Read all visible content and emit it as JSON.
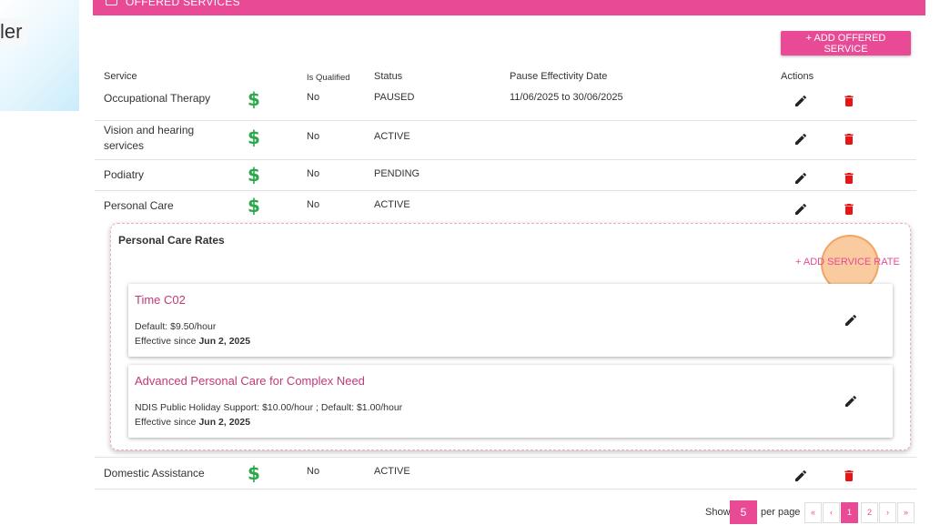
{
  "left_fragment": "ler",
  "panel_header": {
    "title": "OFFERED SERVICES"
  },
  "toolbar": {
    "add_offered_service": "+ ADD OFFERED SERVICE"
  },
  "table": {
    "headers": {
      "service": "Service",
      "is_qualified": "Is Qualified",
      "status": "Status",
      "pause": "Pause Effectivity Date",
      "actions": "Actions"
    },
    "rows": [
      {
        "service": "Occupational Therapy",
        "dollar": "$",
        "qualified": "No",
        "status": "PAUSED",
        "pause": "11/06/2025 to 30/06/2025"
      },
      {
        "service": "Vision and hearing services",
        "dollar": "$",
        "qualified": "No",
        "status": "ACTIVE",
        "pause": ""
      },
      {
        "service": "Podiatry",
        "dollar": "$",
        "qualified": "No",
        "status": "PENDING",
        "pause": ""
      },
      {
        "service": "Personal Care",
        "dollar": "$",
        "qualified": "No",
        "status": "ACTIVE",
        "pause": ""
      },
      {
        "service": "Domestic Assistance",
        "dollar": "$",
        "qualified": "No",
        "status": "ACTIVE",
        "pause": ""
      }
    ]
  },
  "rates": {
    "title": "Personal Care Rates",
    "add_label": "+ ADD SERVICE RATE",
    "effective_prefix": "Effective since ",
    "cards": [
      {
        "name": "Time C02",
        "desc": "Default: $9.50/hour",
        "date": "Jun 2, 2025"
      },
      {
        "name": "Advanced Personal Care for Complex Need",
        "desc": "NDIS Public Holiday Support: $10.00/hour ; Default: $1.00/hour",
        "date": "Jun 2, 2025"
      }
    ]
  },
  "pagination": {
    "show_label": "Show",
    "per_page_value": "5",
    "per_page_label": "per page",
    "first": "«",
    "prev": "‹",
    "pages": [
      "1",
      "2"
    ],
    "next": "›",
    "last": "»"
  },
  "colors": {
    "accent": "#e84a96",
    "dollar": "#2aa84a",
    "delete": "#e81515",
    "highlight": "#f5a050"
  },
  "icons": {
    "edit": "pencil-icon",
    "delete": "trash-icon",
    "header": "square-icon"
  }
}
